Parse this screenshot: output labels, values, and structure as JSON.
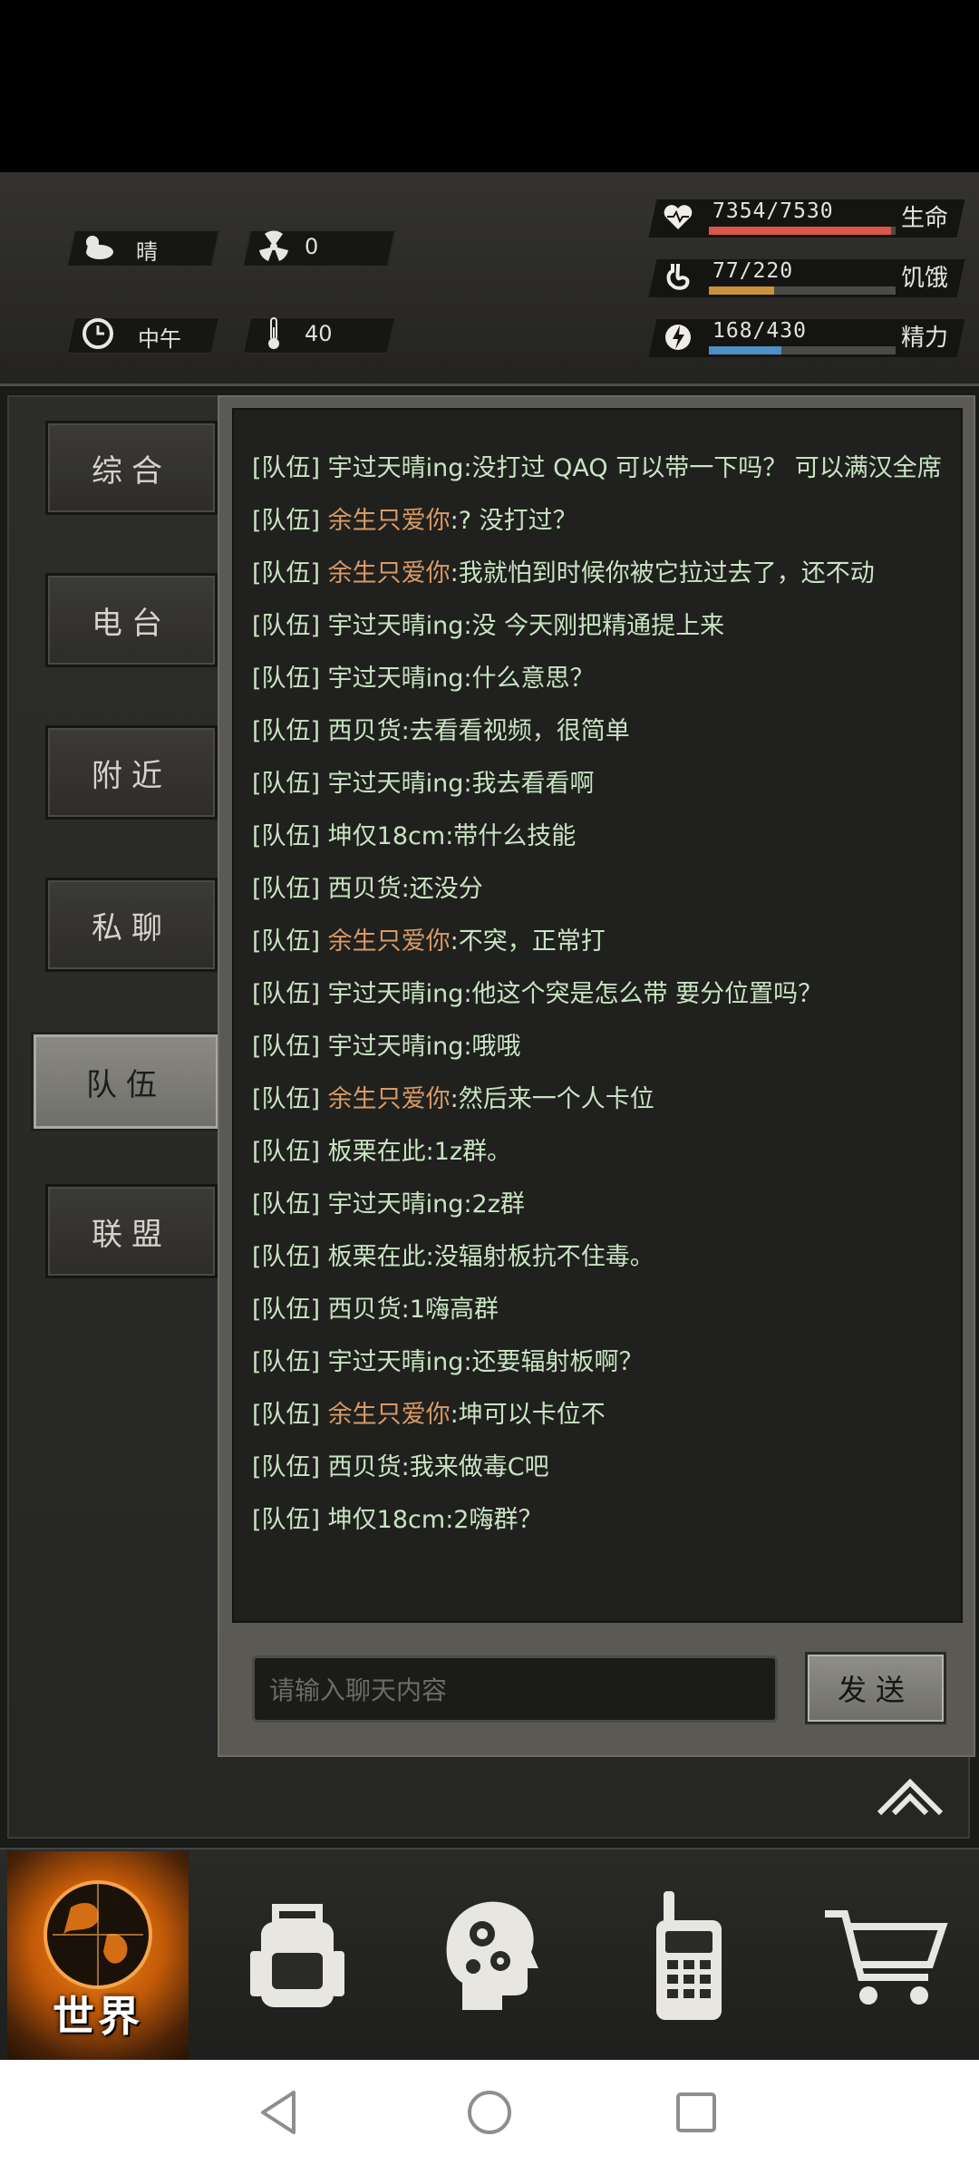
{
  "status": {
    "weather": "晴",
    "radiation": "0",
    "time_of_day": "中午",
    "temperature": "40",
    "health": {
      "value": "7354/7530",
      "label": "生命",
      "fraction": 0.977,
      "color": "#d9574b"
    },
    "hunger": {
      "value": "77/220",
      "label": "饥饿",
      "fraction": 0.35,
      "color": "#c8913a"
    },
    "energy": {
      "value": "168/430",
      "label": "精力",
      "fraction": 0.39,
      "color": "#4f8ec6"
    }
  },
  "sidebar": {
    "tabs": [
      {
        "label": "综合"
      },
      {
        "label": "电台"
      },
      {
        "label": "附近"
      },
      {
        "label": "私聊"
      },
      {
        "label": "队伍"
      },
      {
        "label": "联盟"
      }
    ]
  },
  "chat": {
    "messages": [
      {
        "tag": "[队伍]",
        "name": "宇过天晴ing",
        "text": ":没打过 QAQ 可以带一下吗？ 可以满汉全席",
        "orange": false
      },
      {
        "tag": "[队伍]",
        "name": "余生只爱你",
        "text": ":? 没打过？",
        "orange": true
      },
      {
        "tag": "[队伍]",
        "name": "余生只爱你",
        "text": ":我就怕到时候你被它拉过去了，还不动",
        "orange": true
      },
      {
        "tag": "[队伍]",
        "name": "宇过天晴ing",
        "text": ":没 今天刚把精通提上来",
        "orange": false
      },
      {
        "tag": "[队伍]",
        "name": "宇过天晴ing",
        "text": ":什么意思？",
        "orange": false
      },
      {
        "tag": "[队伍]",
        "name": "西贝货",
        "text": ":去看看视频，很简单",
        "orange": false
      },
      {
        "tag": "[队伍]",
        "name": "宇过天晴ing",
        "text": ":我去看看啊",
        "orange": false
      },
      {
        "tag": "[队伍]",
        "name": "坤仅18cm",
        "text": ":带什么技能",
        "orange": false
      },
      {
        "tag": "[队伍]",
        "name": "西贝货",
        "text": ":还没分",
        "orange": false
      },
      {
        "tag": "[队伍]",
        "name": "余生只爱你",
        "text": ":不突，正常打",
        "orange": true
      },
      {
        "tag": "[队伍]",
        "name": "宇过天晴ing",
        "text": ":他这个突是怎么带 要分位置吗？",
        "orange": false
      },
      {
        "tag": "[队伍]",
        "name": "宇过天晴ing",
        "text": ":哦哦",
        "orange": false
      },
      {
        "tag": "[队伍]",
        "name": "余生只爱你",
        "text": ":然后来一个人卡位",
        "orange": true
      },
      {
        "tag": "[队伍]",
        "name": "板栗在此",
        "text": ":1z群。",
        "orange": false
      },
      {
        "tag": "[队伍]",
        "name": "宇过天晴ing",
        "text": ":2z群",
        "orange": false
      },
      {
        "tag": "[队伍]",
        "name": "板栗在此",
        "text": ":没辐射板抗不住毒。",
        "orange": false
      },
      {
        "tag": "[队伍]",
        "name": "西贝货",
        "text": ":1嗨高群",
        "orange": false
      },
      {
        "tag": "[队伍]",
        "name": "宇过天晴ing",
        "text": ":还要辐射板啊？",
        "orange": false
      },
      {
        "tag": "[队伍]",
        "name": "余生只爱你",
        "text": ":坤可以卡位不",
        "orange": true
      },
      {
        "tag": "[队伍]",
        "name": "西贝货",
        "text": ":我来做毒C吧",
        "orange": false
      },
      {
        "tag": "[队伍]",
        "name": "坤仅18cm",
        "text": ":2嗨群？",
        "orange": false
      }
    ],
    "input_placeholder": "请输入聊天内容",
    "send_label": "发送"
  },
  "bottom_nav": {
    "world_label": "世界"
  }
}
